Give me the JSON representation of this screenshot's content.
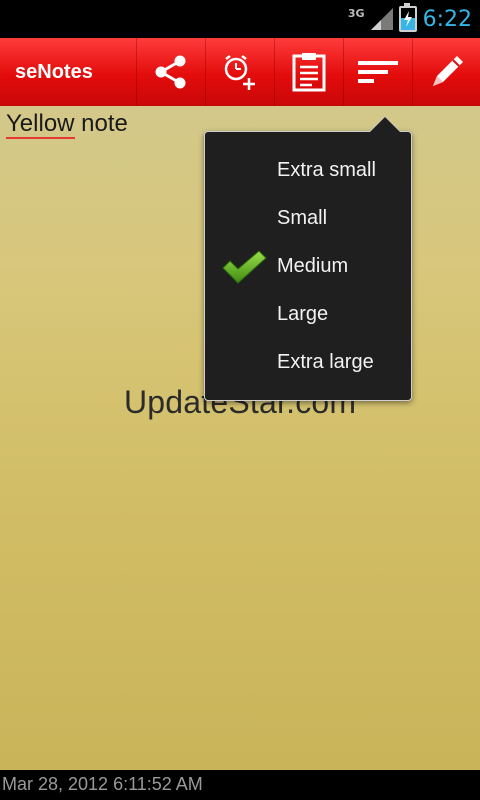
{
  "status_bar": {
    "network": "3G",
    "time": "6:22",
    "colors": {
      "time": "#33b5e5",
      "battery_fill": "#37b5e6"
    }
  },
  "action_bar": {
    "title": "seNotes",
    "accent": "#e30c0c",
    "icons": [
      "share-icon",
      "alarm-add-icon",
      "clipboard-icon",
      "text-size-icon",
      "pencil-icon"
    ]
  },
  "note": {
    "title_word_1": "Yellow",
    "title_word_2": " note",
    "background": "#d8c77b"
  },
  "popup_menu": {
    "items": [
      {
        "label": "Extra small",
        "checked": false
      },
      {
        "label": "Small",
        "checked": false
      },
      {
        "label": "Medium",
        "checked": true
      },
      {
        "label": "Large",
        "checked": false
      },
      {
        "label": "Extra large",
        "checked": false
      }
    ]
  },
  "watermark": "UpdateStar.com",
  "footer": {
    "timestamp": "Mar 28, 2012 6:11:52 AM"
  }
}
